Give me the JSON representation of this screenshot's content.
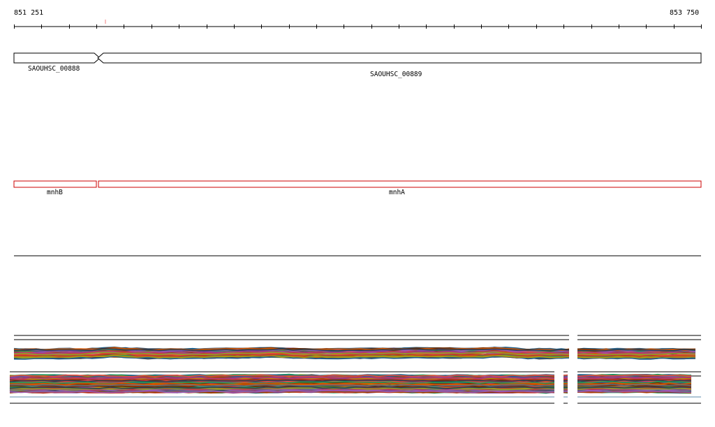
{
  "ruler": {
    "start_label": "851 251",
    "end_label": "853 750"
  },
  "genes": [
    {
      "label": "SAOUHSC_00888",
      "strand": "plus"
    },
    {
      "label": "SAOUHSC_00889",
      "strand": "minus"
    }
  ],
  "features": [
    {
      "label": "mnhB",
      "color": "#cc0000"
    },
    {
      "label": "mnhA",
      "color": "#cc0000"
    }
  ],
  "colors": {
    "gene_outline": "#000000",
    "feature_outline": "#cc0000",
    "ruler_marker": "#f08080"
  },
  "tracks": {
    "coverage_palette": [
      "#c0392b",
      "#8e9c2f",
      "#d35400",
      "#2c3e50",
      "#b03a78",
      "#5d6d7e",
      "#a04000",
      "#7d3c98",
      "#1f618d",
      "#239b56",
      "#e74c3c",
      "#6e2c00",
      "#9b59b6",
      "#b7950b"
    ]
  }
}
